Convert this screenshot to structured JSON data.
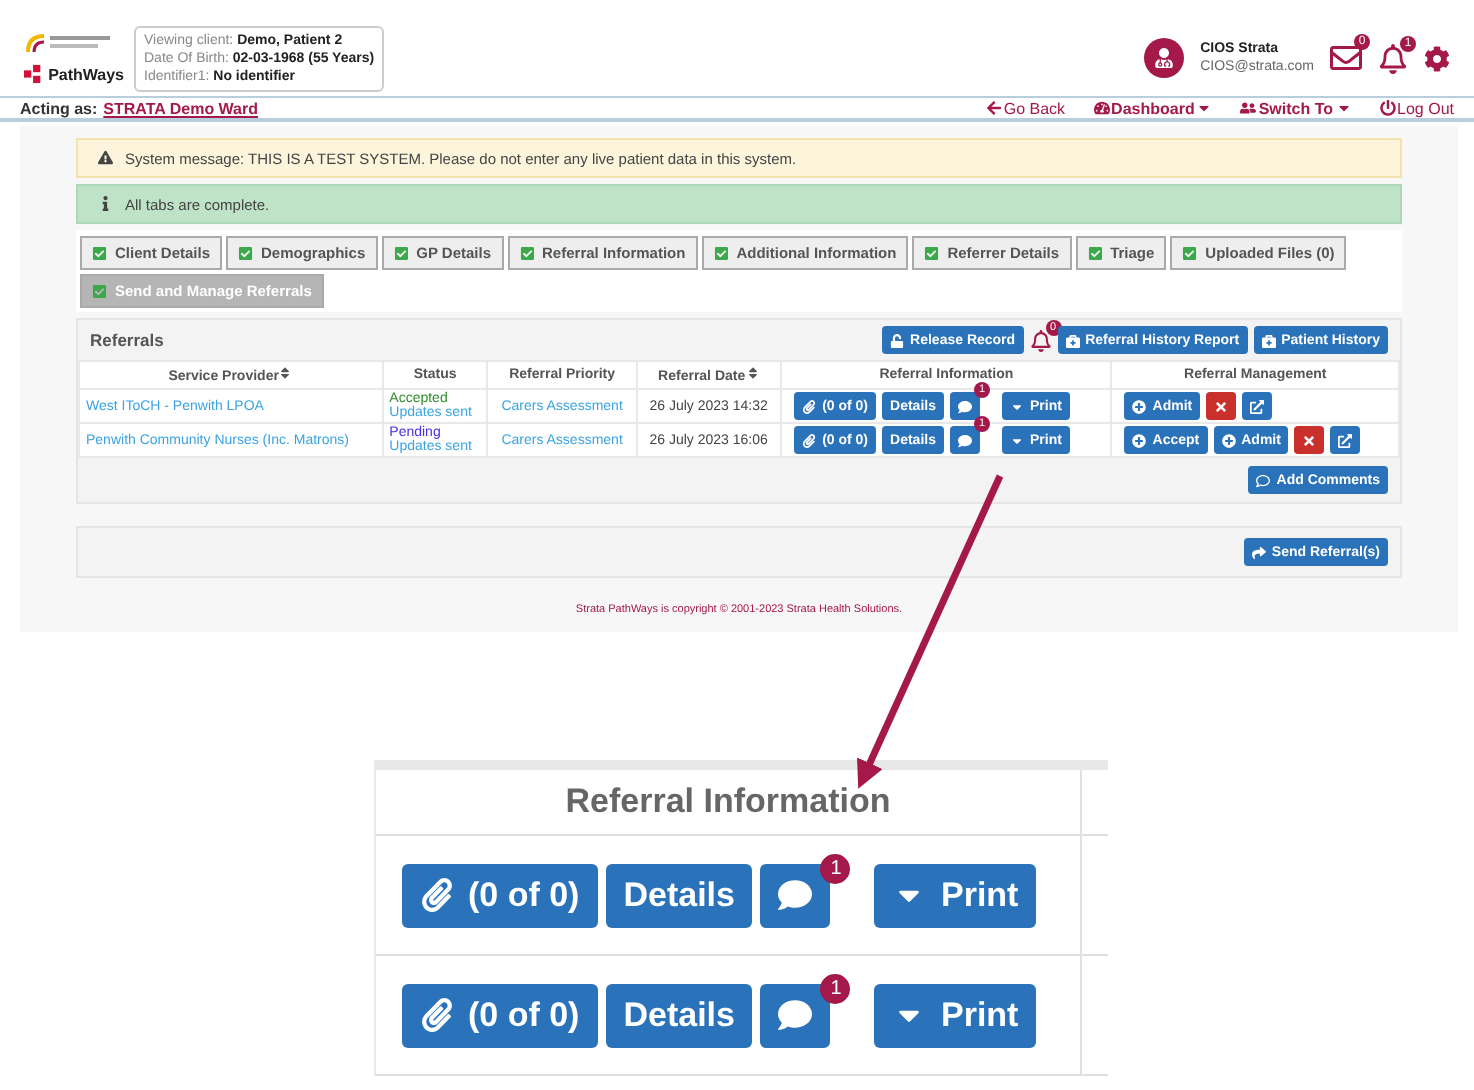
{
  "header": {
    "logo_text": "PathWays",
    "client": [
      {
        "label": "Viewing client:",
        "value": "Demo, Patient 2"
      },
      {
        "label": "Date Of Birth:",
        "value": "02-03-1968 (55 Years)"
      },
      {
        "label": "Identifier1:",
        "value": "No identifier"
      }
    ],
    "user": {
      "name": "CIOS Strata",
      "email": "CIOS@strata.com"
    },
    "mail_badge": "0",
    "bell_badge": "1"
  },
  "acting_as": {
    "label": "Acting as:",
    "value": "STRATA Demo Ward"
  },
  "nav": [
    {
      "kind": "back",
      "label": "Go Back",
      "dropdown": false
    },
    {
      "kind": "dashboard",
      "label": "Dashboard",
      "dropdown": true
    },
    {
      "kind": "switch",
      "label": "Switch To",
      "dropdown": true
    },
    {
      "kind": "logout",
      "label": "Log Out",
      "dropdown": false
    }
  ],
  "system_message": "System message: THIS IS A TEST SYSTEM. Please do not enter any live patient data in this system.",
  "info_message": "All tabs are complete.",
  "tabs": [
    {
      "label": "Client Details",
      "selected": false
    },
    {
      "label": "Demographics",
      "selected": false
    },
    {
      "label": "GP Details",
      "selected": false
    },
    {
      "label": "Referral Information",
      "selected": false
    },
    {
      "label": "Additional Information",
      "selected": false
    },
    {
      "label": "Referrer Details",
      "selected": false
    },
    {
      "label": "Triage",
      "selected": false
    },
    {
      "label": "Uploaded Files (0)",
      "selected": false
    },
    {
      "label": "Send and Manage Referrals",
      "selected": true
    }
  ],
  "referrals": {
    "title": "Referrals",
    "release": "Release Record",
    "bell_badge": "0",
    "history_report": "Referral History Report",
    "patient_history": "Patient History",
    "columns": [
      {
        "label": "Service Provider",
        "sortable": true
      },
      {
        "label": "Status",
        "sortable": false
      },
      {
        "label": "Referral Priority",
        "sortable": false
      },
      {
        "label": "Referral Date",
        "sortable": true
      },
      {
        "label": "Referral Information",
        "sortable": false
      },
      {
        "label": "Referral Management",
        "sortable": false
      }
    ],
    "rows": [
      {
        "provider": "West IToCH - Penwith LPOA",
        "status": "Accepted",
        "color": "#2e8b2e",
        "updates": "Updates sent",
        "priority": "Carers Assessment",
        "date": "26 July 2023 14:32",
        "files": "(0 of 0)",
        "details": "Details",
        "comment_badge": "1",
        "print": "Print",
        "actions": [
          {
            "kind": "admit",
            "label": "Admit"
          },
          {
            "kind": "remove"
          },
          {
            "kind": "open"
          }
        ]
      },
      {
        "provider": "Penwith Community Nurses (Inc. Matrons)",
        "status": "Pending",
        "color": "#4b2ee0",
        "updates": "Updates sent",
        "priority": "Carers Assessment",
        "date": "26 July 2023 16:06",
        "files": "(0 of 0)",
        "details": "Details",
        "comment_badge": "1",
        "print": "Print",
        "actions": [
          {
            "kind": "accept",
            "label": "Accept"
          },
          {
            "kind": "admit",
            "label": "Admit"
          },
          {
            "kind": "remove"
          },
          {
            "kind": "open"
          }
        ]
      }
    ],
    "add_comments": "Add Comments"
  },
  "send_referrals": "Send Referral(s)",
  "footer": "Strata PathWays is copyright © 2001-2023 Strata Health Solutions.",
  "zoom_inset": {
    "header": "Referral Information",
    "rows": [
      {
        "files": "(0 of 0)",
        "details": "Details",
        "comment_badge": "1",
        "print": "Print"
      },
      {
        "files": "(0 of 0)",
        "details": "Details",
        "comment_badge": "1",
        "print": "Print"
      }
    ]
  }
}
